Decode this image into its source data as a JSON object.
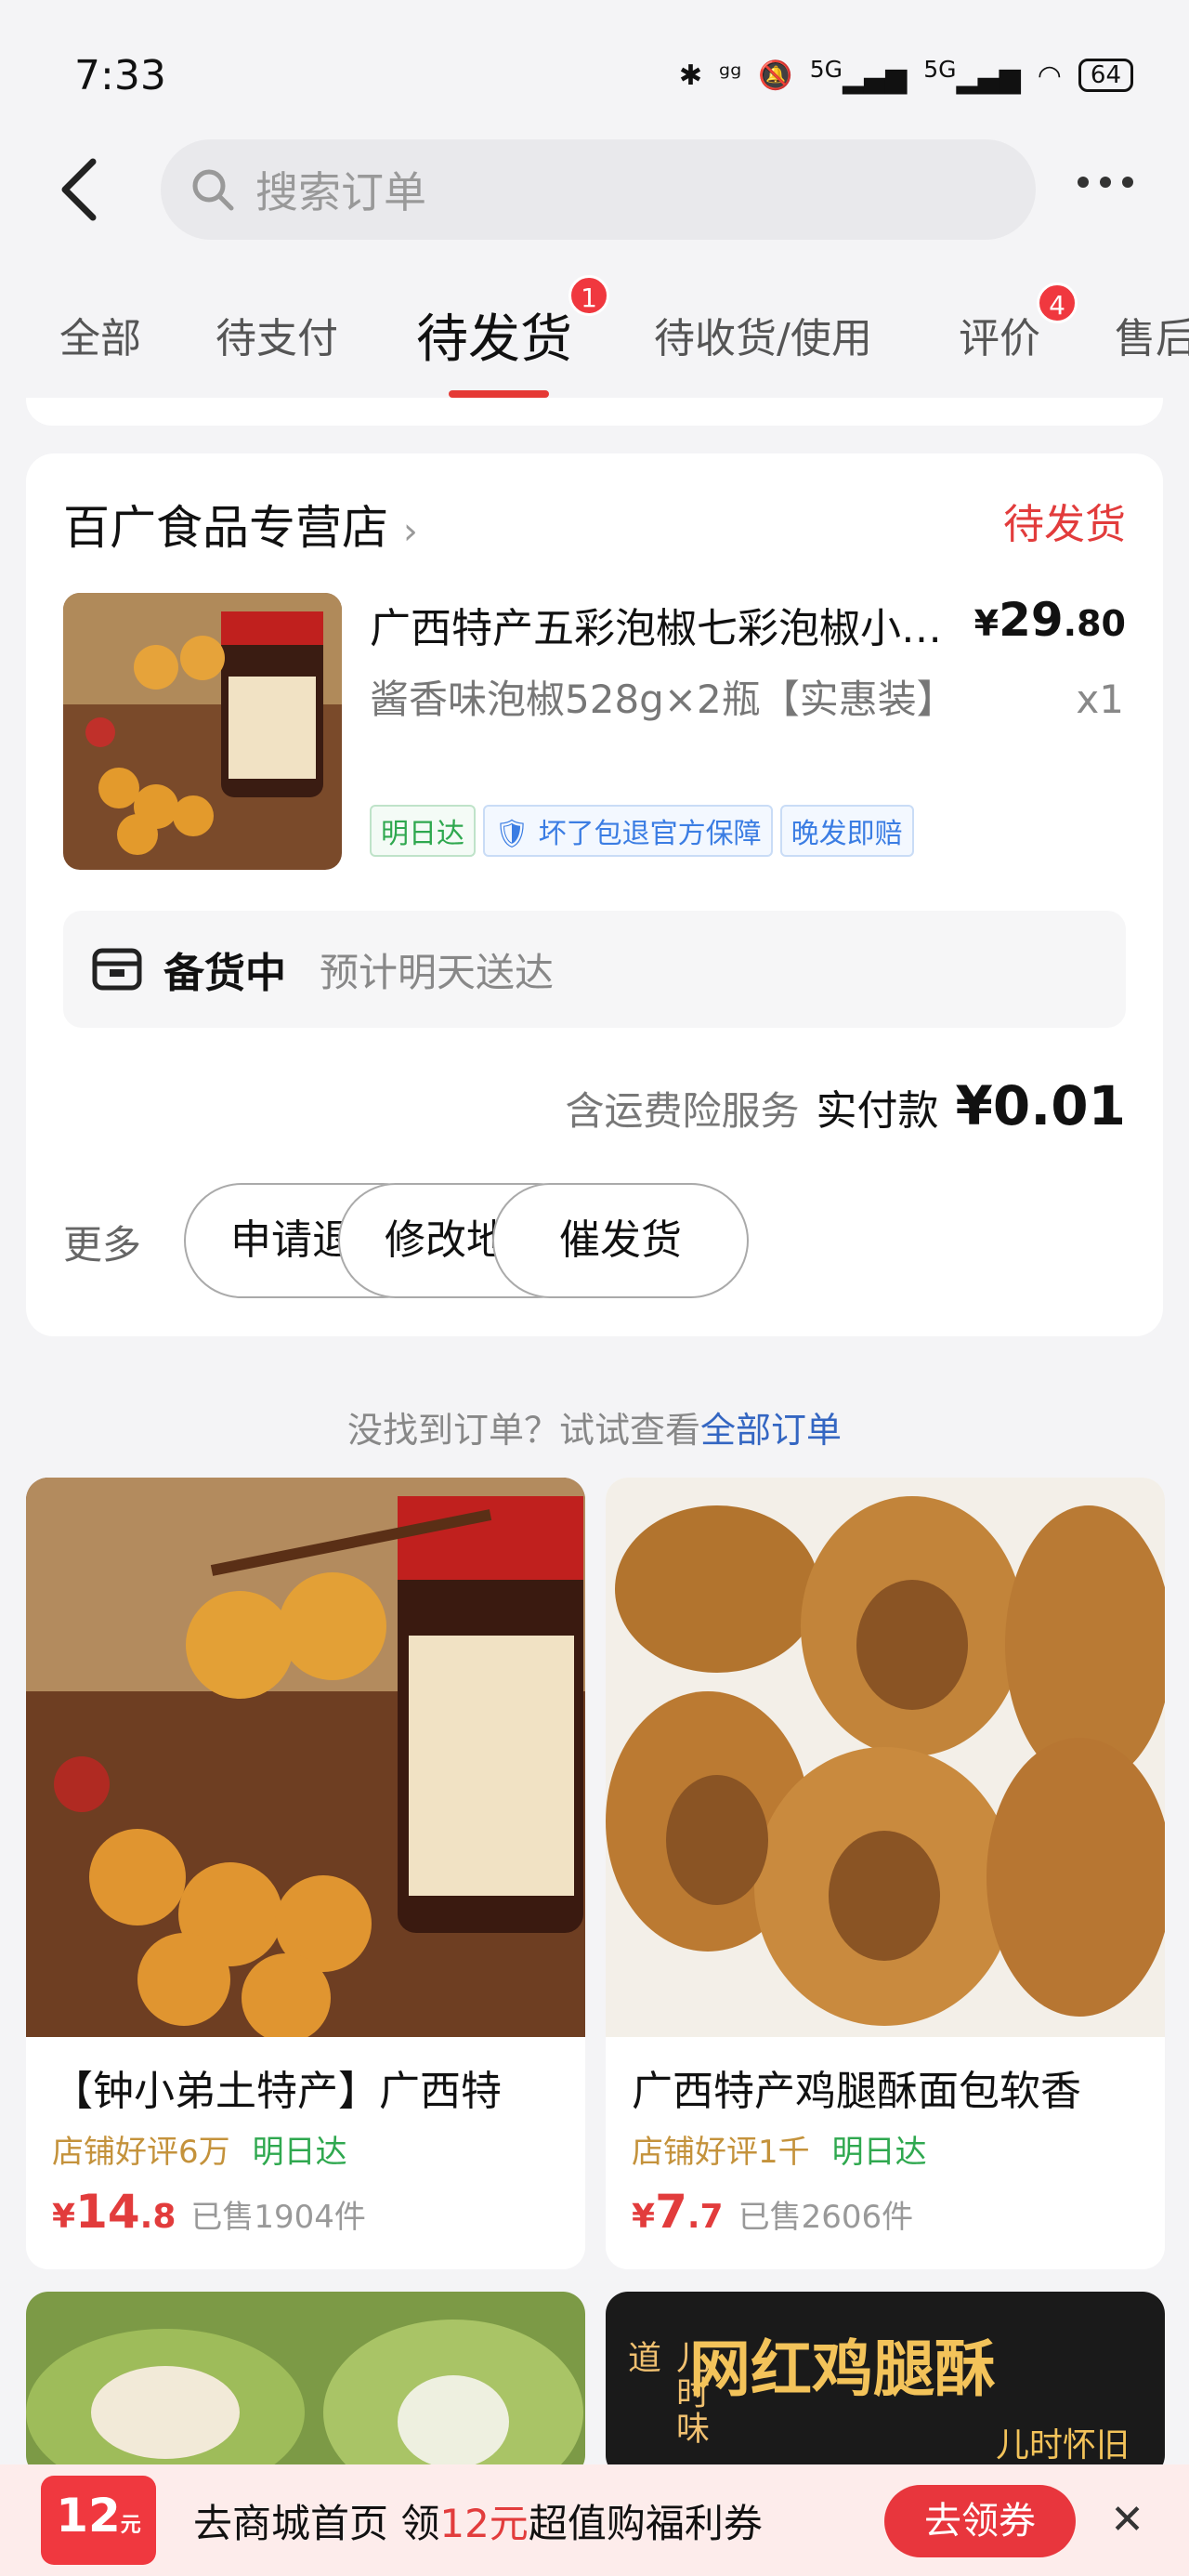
{
  "status_bar": {
    "time": "7:33",
    "battery": "64",
    "net1": "5G",
    "net2": "5G"
  },
  "header": {
    "search_placeholder": "搜索订单"
  },
  "tabs": [
    {
      "label": "全部"
    },
    {
      "label": "待支付"
    },
    {
      "label": "待发货",
      "badge": "1",
      "active": true
    },
    {
      "label": "待收货/使用"
    },
    {
      "label": "评价",
      "badge": "4"
    },
    {
      "label": "售后"
    }
  ],
  "order": {
    "shop_name": "百广食品专营店",
    "status": "待发货",
    "product_name": "广西特产五彩泡椒七彩泡椒小米辣",
    "spec": "酱香味泡椒528g×2瓶【实惠装】",
    "price_symbol": "¥",
    "price_int": "29",
    "price_dec": ".80",
    "qty": "x1",
    "tags": [
      "明日达",
      "坏了包退官方保障",
      "晚发即赔"
    ],
    "progress_label": "备货中",
    "progress_note": "预计明天送达",
    "service_text": "含运费险服务",
    "paid_label": "实付款",
    "paid_amount": "¥0.01",
    "more": "更多",
    "buttons": [
      "申请退款",
      "修改地址",
      "催发货"
    ]
  },
  "hint": {
    "text": "没找到订单？试试查看",
    "link": "全部订单"
  },
  "recommendations": [
    {
      "title": "【钟小弟土特产】广西特",
      "reviews": "店铺好评6万",
      "fast": "明日达",
      "price_int": "14",
      "price_dec": ".8",
      "sold": "已售1904件"
    },
    {
      "title": "广西特产鸡腿酥面包软香",
      "reviews": "店铺好评1千",
      "fast": "明日达",
      "price_int": "7",
      "price_dec": ".7",
      "sold": "已售2606件"
    }
  ],
  "partial_cards": [
    {
      "text1": "儿时味道",
      "text2": "网红鸡腿酥",
      "text3": "儿时怀旧"
    }
  ],
  "banner": {
    "coupon_amount": "12",
    "coupon_unit": "元",
    "text_pre": "去商城首页 领",
    "text_highlight": "12元",
    "text_post": "超值购福利券",
    "button": "去领券"
  }
}
